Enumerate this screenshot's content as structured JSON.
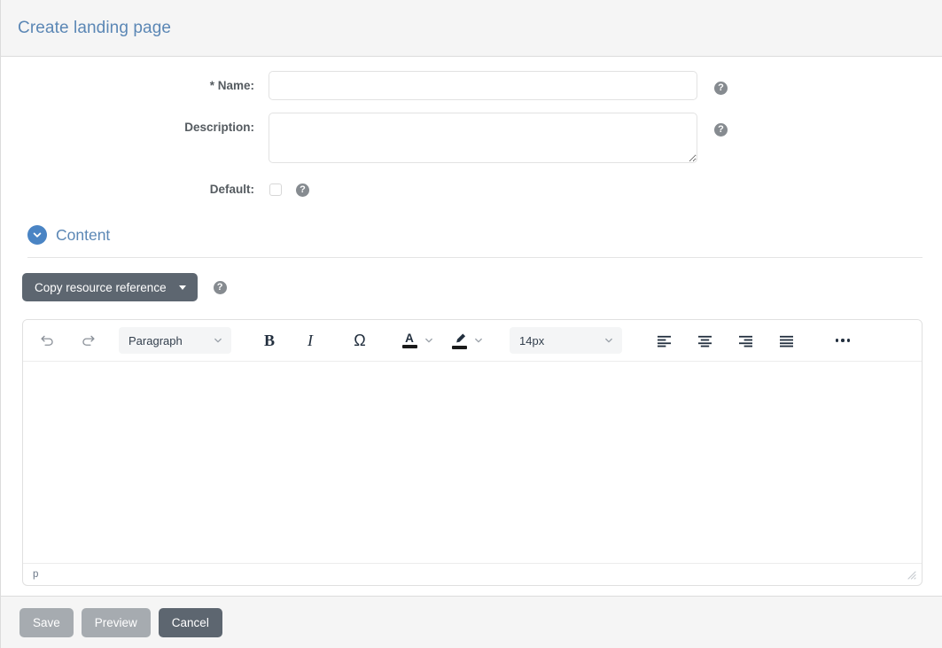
{
  "header": {
    "title": "Create landing page"
  },
  "form": {
    "name": {
      "label": "* Name:",
      "value": "",
      "placeholder": "",
      "help_icon": "question-circle-icon",
      "help_text": "?"
    },
    "description": {
      "label": "Description:",
      "value": "",
      "placeholder": "",
      "help_icon": "question-circle-icon",
      "help_text": "?"
    },
    "default": {
      "label": "Default:",
      "checked": false,
      "help_icon": "question-circle-icon",
      "help_text": "?"
    }
  },
  "content_section": {
    "title": "Content",
    "collapse_icon": "chevron-down-circle-icon",
    "expanded": true,
    "copy_resource_reference": {
      "label": "Copy resource reference",
      "caret_icon": "caret-down-icon",
      "help_icon": "question-circle-icon",
      "help_text": "?"
    }
  },
  "editor": {
    "toolbar": {
      "undo": {
        "label": "Undo",
        "icon": "undo-arrow-icon"
      },
      "redo": {
        "label": "Redo",
        "icon": "redo-arrow-icon"
      },
      "block_format": {
        "value": "Paragraph",
        "chevron_icon": "chevron-down-icon"
      },
      "bold": {
        "label": "B",
        "icon": "bold-icon"
      },
      "italic": {
        "label": "I",
        "icon": "italic-icon"
      },
      "special_char": {
        "label": "Ω",
        "icon": "omega-special-character-icon"
      },
      "text_color": {
        "label": "A",
        "icon": "text-color-icon",
        "color": "#1a1a1a",
        "chevron_icon": "chevron-down-icon"
      },
      "highlight_color": {
        "icon": "highlight-pen-icon",
        "color": "#1a1a1a",
        "chevron_icon": "chevron-down-icon"
      },
      "font_size": {
        "value": "14px",
        "chevron_icon": "chevron-down-icon"
      },
      "align_left": {
        "icon": "align-left-icon"
      },
      "align_center": {
        "icon": "align-center-icon"
      },
      "align_right": {
        "icon": "align-right-icon"
      },
      "align_justify": {
        "icon": "align-justify-icon"
      },
      "more": {
        "icon": "more-horizontal-icon"
      }
    },
    "body_content": "",
    "status_path": "p",
    "resize_icon": "resize-grip-icon"
  },
  "footer": {
    "save_label": "Save",
    "preview_label": "Preview",
    "cancel_label": "Cancel"
  },
  "colors": {
    "accent_blue": "#5b87b5",
    "toggle_blue": "#4a84c4",
    "button_slate": "#5d6670",
    "button_muted": "#a6abb0",
    "header_bg": "#f5f5f5"
  }
}
